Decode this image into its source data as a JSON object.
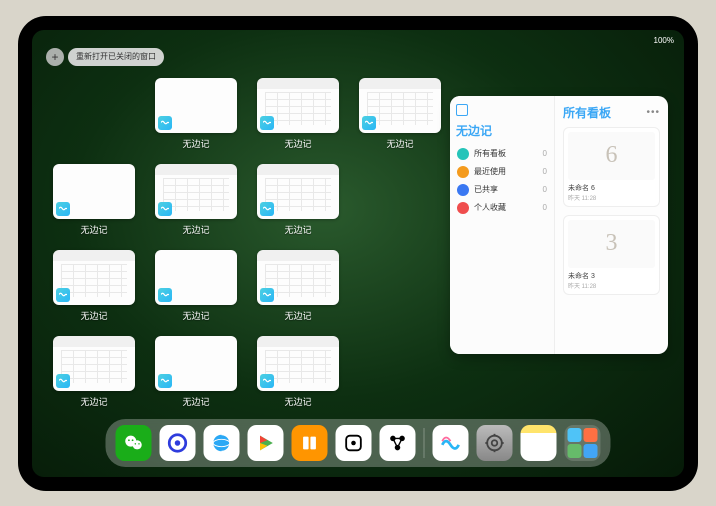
{
  "status": {
    "time": "",
    "battery_text": "100%",
    "signal": "•••"
  },
  "toolbar": {
    "plus_label": "+",
    "reopen_label": "重新打开已关闭的窗口"
  },
  "windows": [
    {
      "label": "无边记",
      "has_content": false
    },
    {
      "label": "无边记",
      "has_content": true
    },
    {
      "label": "无边记",
      "has_content": true
    },
    {
      "label": "无边记",
      "has_content": false
    },
    {
      "label": "无边记",
      "has_content": true
    },
    {
      "label": "无边记",
      "has_content": true
    },
    {
      "label": "无边记",
      "has_content": false
    },
    {
      "label": "无边记",
      "has_content": true
    },
    {
      "label": "无边记",
      "has_content": true
    },
    {
      "label": "无边记",
      "has_content": false
    },
    {
      "label": "无边记",
      "has_content": true
    },
    {
      "label": "无边记",
      "has_content": true
    }
  ],
  "panel": {
    "left_title": "无边记",
    "right_title": "所有看板",
    "more": "•••",
    "nav": [
      {
        "icon_color": "#25c4b9",
        "label": "所有看板",
        "count": "0"
      },
      {
        "icon_color": "#f49b1e",
        "label": "最近使用",
        "count": "0"
      },
      {
        "icon_color": "#3a78f2",
        "label": "已共享",
        "count": "0"
      },
      {
        "icon_color": "#ef4d4d",
        "label": "个人收藏",
        "count": "0"
      }
    ],
    "boards": [
      {
        "glyph": "6",
        "name": "未命名 6",
        "date": "昨天 11:28"
      },
      {
        "glyph": "3",
        "name": "未命名 3",
        "date": "昨天 11:28"
      }
    ]
  },
  "dock": {
    "apps": [
      {
        "name": "wechat",
        "bg": "#1aad19"
      },
      {
        "name": "quark",
        "bg": "#ffffff"
      },
      {
        "name": "qqbrowser",
        "bg": "#ffffff"
      },
      {
        "name": "play",
        "bg": "#ffffff"
      },
      {
        "name": "books",
        "bg": "#ff9500"
      },
      {
        "name": "dice",
        "bg": "#ffffff"
      },
      {
        "name": "connect",
        "bg": "#ffffff"
      },
      {
        "name": "freeform",
        "bg": "#ffffff"
      },
      {
        "name": "settings",
        "bg": "#8e8e93"
      },
      {
        "name": "notes",
        "bg": "#ffffff"
      }
    ]
  }
}
